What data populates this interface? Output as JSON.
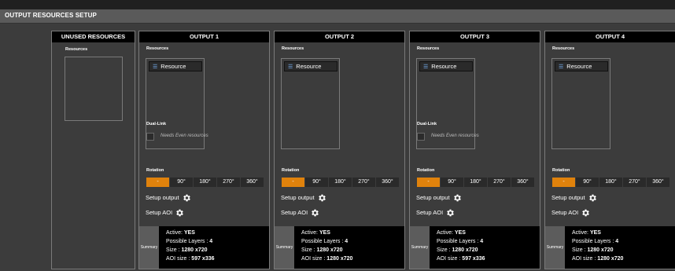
{
  "window": {
    "title": "OUTPUT RESOURCES SETUP"
  },
  "unused": {
    "title": "UNUSED RESOURCES",
    "resources_label": "Resources"
  },
  "labels": {
    "resources": "Resources",
    "dual_link": "Dual-Link",
    "needs_even": "Needs Even resources",
    "rotation": "Rotation",
    "setup_output": "Setup output",
    "setup_aoi": "Setup AOI",
    "summary": "Summary",
    "active": "Active:",
    "possible_layers": "Possible Layers :",
    "size": "Size :",
    "aoi_size": "AOI size :"
  },
  "rotation_options": [
    "-",
    "90°",
    "180°",
    "270°",
    "360°"
  ],
  "outputs": [
    {
      "title": "OUTPUT 1",
      "resource": "Resource",
      "dual_link": true,
      "rotation_selected": "-",
      "active": "YES",
      "layers": "4",
      "size": "1280 x720",
      "aoi_size": "597 x336"
    },
    {
      "title": "OUTPUT 2",
      "resource": "Resource",
      "dual_link": false,
      "rotation_selected": "-",
      "active": "YES",
      "layers": "4",
      "size": "1280 x720",
      "aoi_size": "1280 x720"
    },
    {
      "title": "OUTPUT 3",
      "resource": "Resource",
      "dual_link": true,
      "rotation_selected": "-",
      "active": "YES",
      "layers": "4",
      "size": "1280 x720",
      "aoi_size": "597 x336"
    },
    {
      "title": "OUTPUT 4",
      "resource": "Resource",
      "dual_link": false,
      "rotation_selected": "-",
      "active": "YES",
      "layers": "4",
      "size": "1280 x720",
      "aoi_size": "1280 x720"
    }
  ],
  "colors": {
    "accent": "#e0820c",
    "header": "#000000",
    "panel": "#3c3c3c",
    "titlebar": "#5a5a5a"
  },
  "icons": {
    "resource": "layers-icon",
    "setup": "gear-icon"
  }
}
